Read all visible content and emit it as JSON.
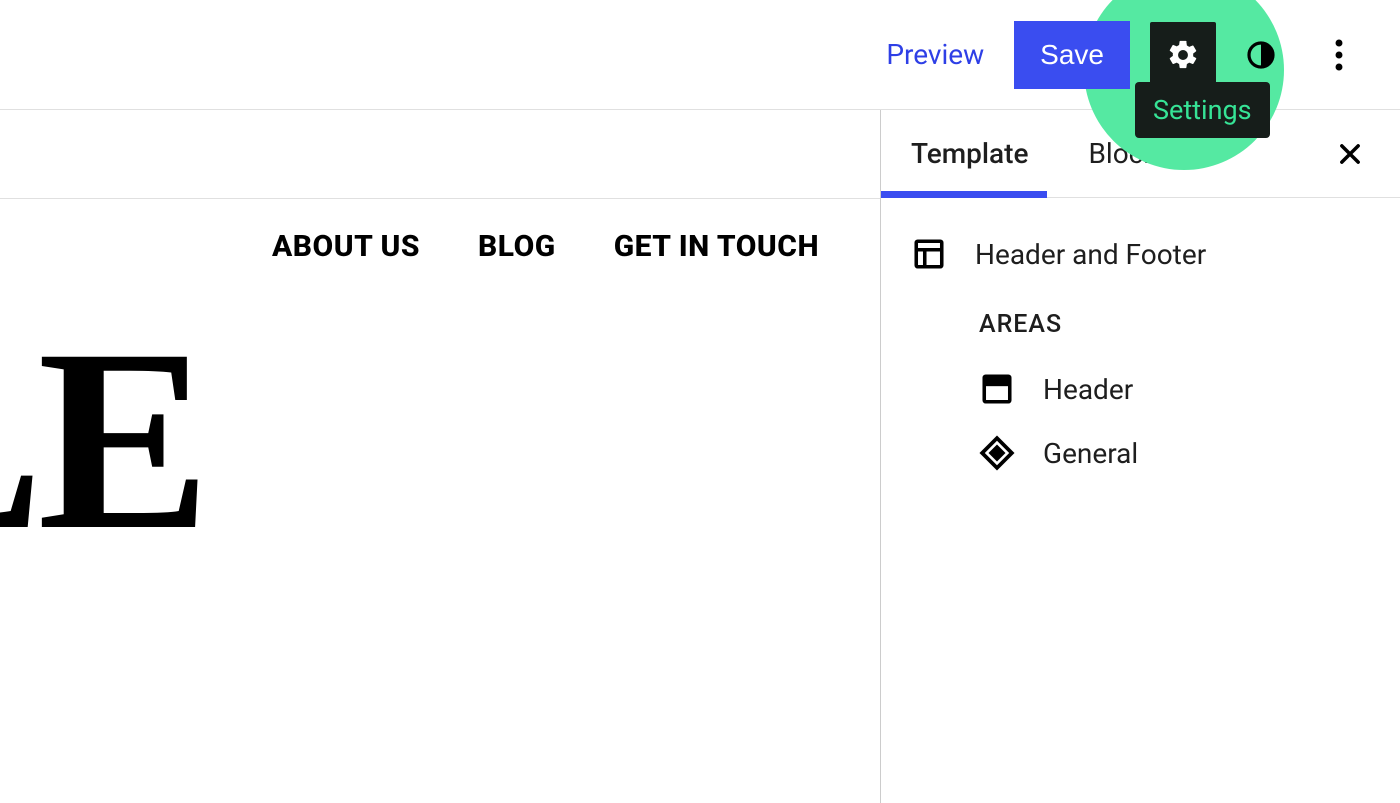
{
  "toolbar": {
    "preview": "Preview",
    "save": "Save",
    "settings_tooltip": "Settings"
  },
  "canvas": {
    "nav": [
      "ABOUT US",
      "BLOG",
      "GET IN TOUCH"
    ],
    "hero_fragment": "LE"
  },
  "sidebar": {
    "tabs": {
      "template": "Template",
      "block": "Block"
    },
    "template_name": "Header and Footer",
    "areas_heading": "AREAS",
    "areas": [
      {
        "label": "Header"
      },
      {
        "label": "General"
      }
    ]
  }
}
